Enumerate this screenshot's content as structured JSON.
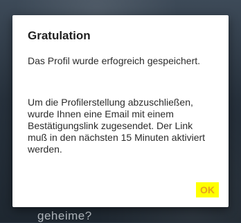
{
  "background": {
    "obscured_text": "geheime?"
  },
  "dialog": {
    "title": "Gratulation",
    "message_1": "Das Profil wurde erfogreich gespeichert.",
    "message_2": "Um die Profilerstellung abzuschließen, wurde Ihnen eine Email mit einem Bestätigungslink zugesendet. Der Link muß in den nächsten 15 Minuten aktiviert werden.",
    "ok_label": "OK"
  },
  "colors": {
    "ok_text": "#e7a11d",
    "ok_highlight": "#ffff00",
    "dialog_bg": "#ffffff"
  }
}
